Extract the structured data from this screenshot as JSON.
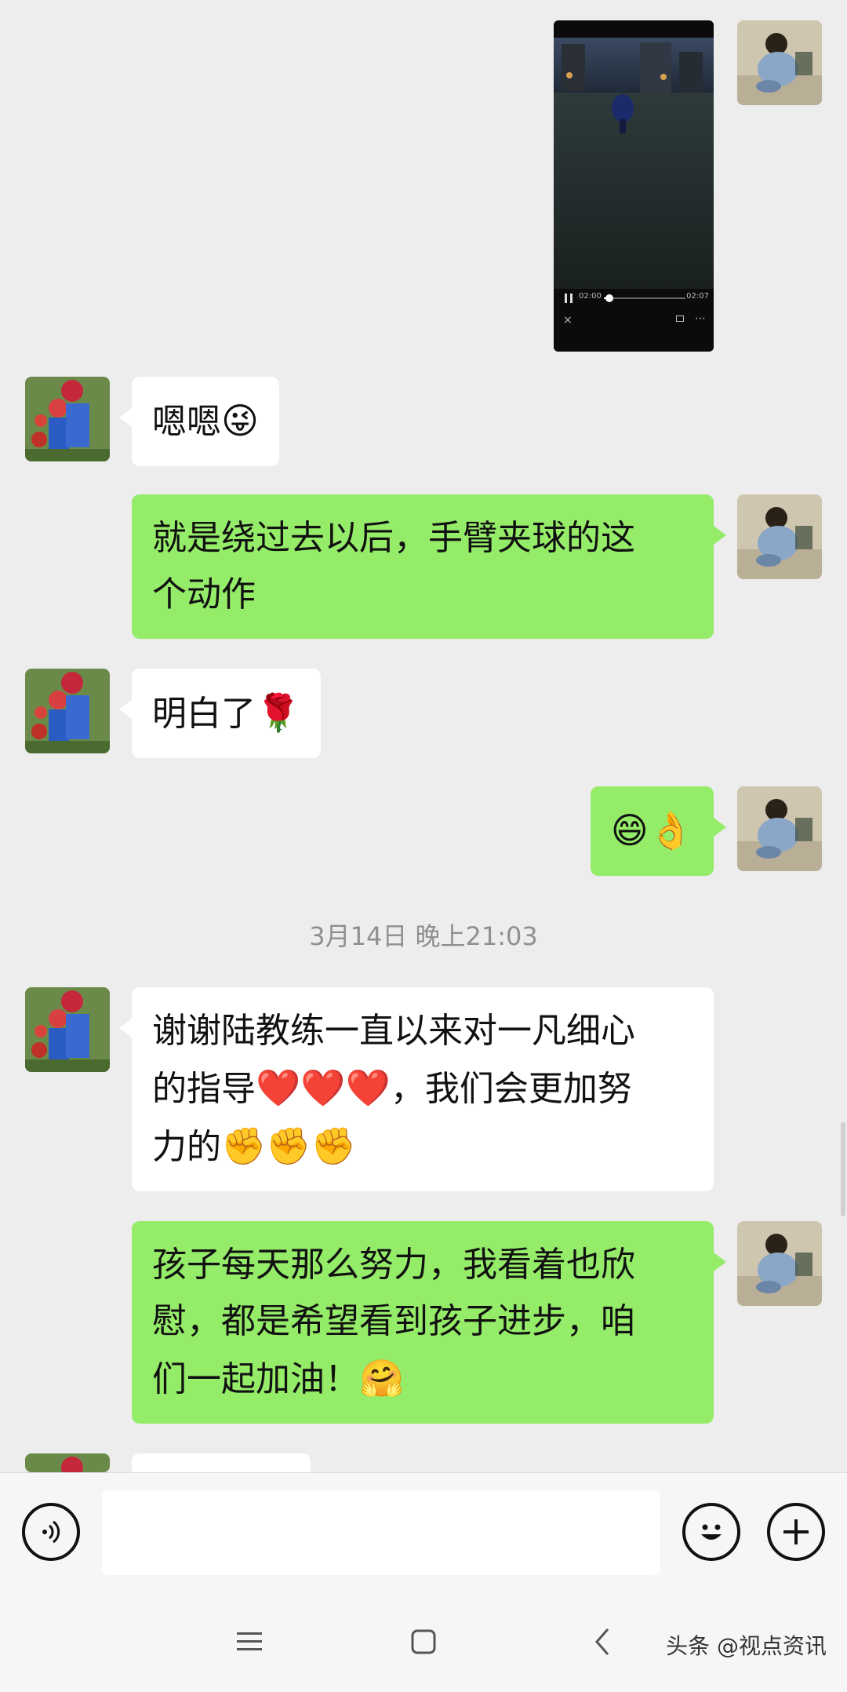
{
  "video": {
    "current_time": "02:00",
    "duration": "02:07",
    "progress": 0.05
  },
  "messages": [
    {
      "side": "in",
      "text": "嗯嗯",
      "emoji": "😜"
    },
    {
      "side": "out",
      "line1": "就是绕过去以后，手臂夹球的这",
      "line2": "个动作"
    },
    {
      "side": "in",
      "text": "明白了",
      "emoji": "🌹"
    },
    {
      "side": "out",
      "emoji": "😄👌"
    },
    {
      "side": "in",
      "line1": "谢谢陆教练一直以来对一凡细心",
      "line2_text": "的指导",
      "line2_emoji": "❤️❤️❤️",
      "line2_tail": "，我们会更加努",
      "line3_text": "力的",
      "line3_emoji": "✊✊✊"
    },
    {
      "side": "out",
      "line1": "孩子每天那么努力，我看着也欣",
      "line2": "慰，都是希望看到孩子进步，咱",
      "line3_text": "们一起加油！",
      "line3_emoji": "🤗"
    }
  ],
  "timestamp": "3月14日 晚上21:03",
  "input": {
    "placeholder": ""
  },
  "icons": {
    "voice": "voice-icon",
    "emoji": "emoji-icon",
    "plus": "plus-icon",
    "menu": "menu-icon",
    "home": "home-icon",
    "back": "back-icon"
  },
  "colors": {
    "outgoing_bubble": "#95ec69",
    "incoming_bubble": "#ffffff",
    "background": "#ededed"
  },
  "watermark": "头条 @视点资讯"
}
